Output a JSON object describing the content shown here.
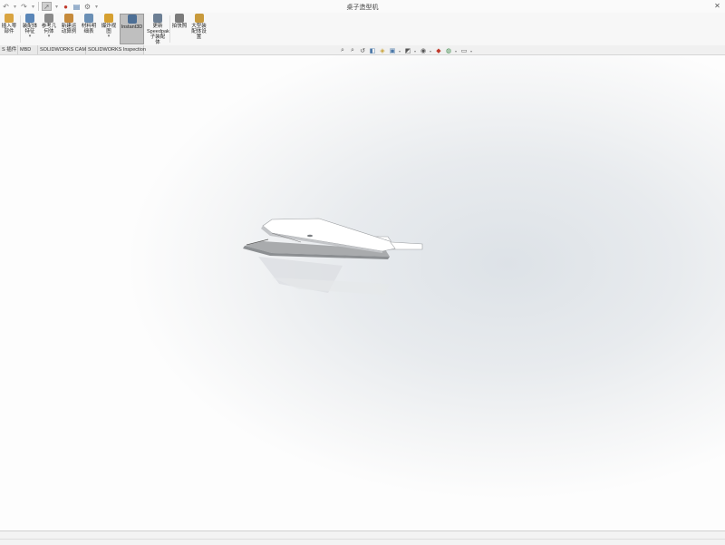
{
  "window": {
    "title": "桌子造型机",
    "close_glyph": "✕"
  },
  "quick_access": {
    "items": [
      {
        "name": "undo-icon",
        "glyph": "↶"
      },
      {
        "name": "redo-icon",
        "glyph": "↷"
      },
      {
        "name": "select-arrow-icon",
        "glyph": "➚"
      },
      {
        "name": "traffic-light-icon",
        "glyph": "●"
      },
      {
        "name": "file-properties-icon",
        "glyph": "▤"
      },
      {
        "name": "options-gear-icon",
        "glyph": "⚙"
      }
    ]
  },
  "ribbon": {
    "buttons": [
      {
        "id": "insert-components",
        "label": "插入零\n部件",
        "dropdown": "",
        "color": "#d9a441"
      },
      {
        "id": "mate",
        "label": "装配体\n特征",
        "dropdown": "▾",
        "color": "#5a86b8"
      },
      {
        "id": "reference-geometry",
        "label": "参考几\n何体",
        "dropdown": "▾",
        "color": "#8a8a8a"
      },
      {
        "id": "new-motion-study",
        "label": "新建运\n动算例",
        "dropdown": "",
        "color": "#c68a3b"
      },
      {
        "id": "bill-of-materials",
        "label": "材料明\n细表",
        "dropdown": "",
        "color": "#6a8fb5"
      },
      {
        "id": "exploded-view",
        "label": "爆炸视\n图",
        "dropdown": "▾",
        "color": "#d6a030"
      },
      {
        "id": "instant3d",
        "label": "Instant3D",
        "dropdown": "",
        "color": "#4d6f95"
      },
      {
        "id": "update-speedpak",
        "label": "更新\nSpeedpak\n子装配\n体",
        "dropdown": "",
        "color": "#6c7f94"
      },
      {
        "id": "take-snapshot",
        "label": "拍快照",
        "dropdown": "",
        "color": "#7b7b7b"
      },
      {
        "id": "large-assembly-settings",
        "label": "大型装\n配体设\n置",
        "dropdown": "",
        "color": "#c89a3c"
      }
    ]
  },
  "tabs": [
    {
      "label": "S 插件"
    },
    {
      "label": "MBD"
    },
    {
      "label": "SOLIDWORKS CAM"
    },
    {
      "label": "SOLIDWORKS Inspection"
    }
  ],
  "heads_up_toolbar": {
    "items": [
      {
        "name": "zoom-to-fit-icon",
        "glyph": "⌕"
      },
      {
        "name": "zoom-to-area-icon",
        "glyph": "⌕"
      },
      {
        "name": "previous-view-icon",
        "glyph": "↺"
      },
      {
        "name": "section-view-icon",
        "glyph": "◧"
      },
      {
        "name": "dynamic-annotation-icon",
        "glyph": "◈"
      },
      {
        "name": "view-orientation-icon",
        "glyph": "▣"
      },
      {
        "name": "display-style-icon",
        "glyph": "◩"
      },
      {
        "name": "hide-show-items-icon",
        "glyph": "◉"
      },
      {
        "name": "edit-appearance-icon",
        "glyph": "◆"
      },
      {
        "name": "apply-scene-icon",
        "glyph": "◍"
      },
      {
        "name": "view-settings-icon",
        "glyph": "▭"
      }
    ]
  },
  "colors": {
    "ribbon_bg": "#f7f7f7",
    "active_button": "#bfbfbf",
    "viewport_center": "#dde2e7",
    "part_face": "#ffffff",
    "part_shadow": "#a9abad"
  }
}
